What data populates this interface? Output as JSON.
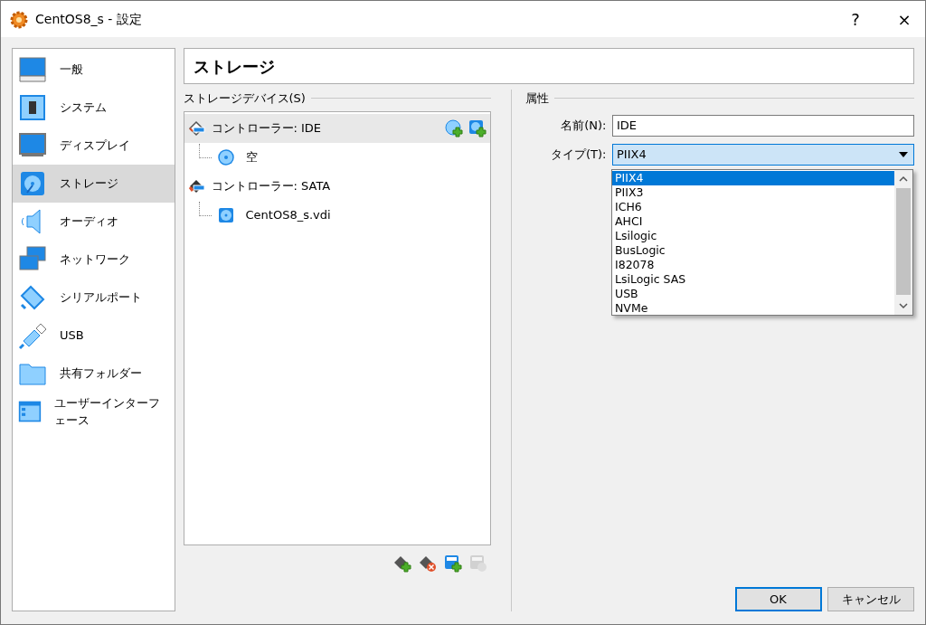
{
  "window": {
    "title": "CentOS8_s - 設定",
    "help": "?",
    "close": "×"
  },
  "sidebar": {
    "items": [
      {
        "label": "一般",
        "kind": "general",
        "selected": false
      },
      {
        "label": "システム",
        "kind": "system",
        "selected": false
      },
      {
        "label": "ディスプレイ",
        "kind": "display",
        "selected": false
      },
      {
        "label": "ストレージ",
        "kind": "storage",
        "selected": true
      },
      {
        "label": "オーディオ",
        "kind": "audio",
        "selected": false
      },
      {
        "label": "ネットワーク",
        "kind": "network",
        "selected": false
      },
      {
        "label": "シリアルポート",
        "kind": "serial",
        "selected": false
      },
      {
        "label": "USB",
        "kind": "usb",
        "selected": false
      },
      {
        "label": "共有フォルダー",
        "kind": "folder",
        "selected": false
      },
      {
        "label": "ユーザーインターフェース",
        "kind": "ui",
        "selected": false
      }
    ]
  },
  "page_title": "ストレージ",
  "storage_devices": {
    "label": "ストレージデバイス(S)",
    "tree": [
      {
        "label": "コントローラー: IDE",
        "kind": "ide",
        "selected": true,
        "children": [
          {
            "label": "空",
            "kind": "optical",
            "selected": false
          }
        ]
      },
      {
        "label": "コントローラー: SATA",
        "kind": "sata",
        "selected": false,
        "children": [
          {
            "label": "CentOS8_s.vdi",
            "kind": "hdd",
            "selected": false
          }
        ]
      }
    ],
    "toolbar": [
      {
        "kind": "add-controller",
        "disabled": false
      },
      {
        "kind": "remove-controller",
        "disabled": false
      },
      {
        "kind": "add-attachment",
        "disabled": false
      },
      {
        "kind": "remove-attachment",
        "disabled": true
      }
    ]
  },
  "attributes": {
    "label": "属性",
    "name_label": "名前(N):",
    "name_value": "IDE",
    "type_label": "タイプ(T):",
    "type_value": "PIIX4",
    "expanded": true,
    "options": [
      {
        "label": "PIIX4",
        "selected": true
      },
      {
        "label": "PIIX3",
        "selected": false
      },
      {
        "label": "ICH6",
        "selected": false
      },
      {
        "label": "AHCI",
        "selected": false
      },
      {
        "label": "Lsilogic",
        "selected": false
      },
      {
        "label": "BusLogic",
        "selected": false
      },
      {
        "label": "I82078",
        "selected": false
      },
      {
        "label": "LsiLogic SAS",
        "selected": false
      },
      {
        "label": "USB",
        "selected": false
      },
      {
        "label": "NVMe",
        "selected": false
      }
    ]
  },
  "buttons": [
    {
      "label": "OK",
      "default": true
    },
    {
      "label": "キャンセル",
      "default": false
    }
  ]
}
